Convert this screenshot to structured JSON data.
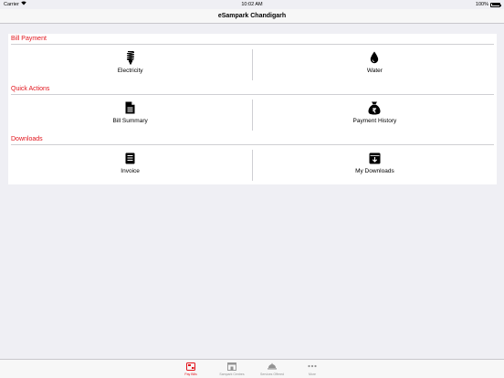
{
  "status_bar": {
    "carrier": "Carrier",
    "time": "10:02 AM",
    "battery": "100%"
  },
  "nav": {
    "title": "eSampark Chandigarh"
  },
  "sections": [
    {
      "header": "Bill Payment",
      "tiles": [
        {
          "label": "Electricity",
          "icon": "lightbulb-icon"
        },
        {
          "label": "Water",
          "icon": "water-drop-icon"
        }
      ]
    },
    {
      "header": "Quick Actions",
      "tiles": [
        {
          "label": "Bill Summary",
          "icon": "document-icon"
        },
        {
          "label": "Payment History",
          "icon": "rupee-bag-icon"
        }
      ]
    },
    {
      "header": "Downloads",
      "tiles": [
        {
          "label": "Invoice",
          "icon": "invoice-icon"
        },
        {
          "label": "My Downloads",
          "icon": "download-box-icon"
        }
      ]
    }
  ],
  "tabs": [
    {
      "label": "Pay Bills",
      "icon": "pay-bills-icon",
      "active": true
    },
    {
      "label": "Sampark Centres",
      "icon": "centres-icon",
      "active": false
    },
    {
      "label": "Services Offered",
      "icon": "services-icon",
      "active": false
    },
    {
      "label": "More",
      "icon": "more-icon",
      "active": false
    }
  ],
  "colors": {
    "accent": "#e2141c",
    "background": "#efeff4",
    "tab_inactive": "#929292"
  }
}
